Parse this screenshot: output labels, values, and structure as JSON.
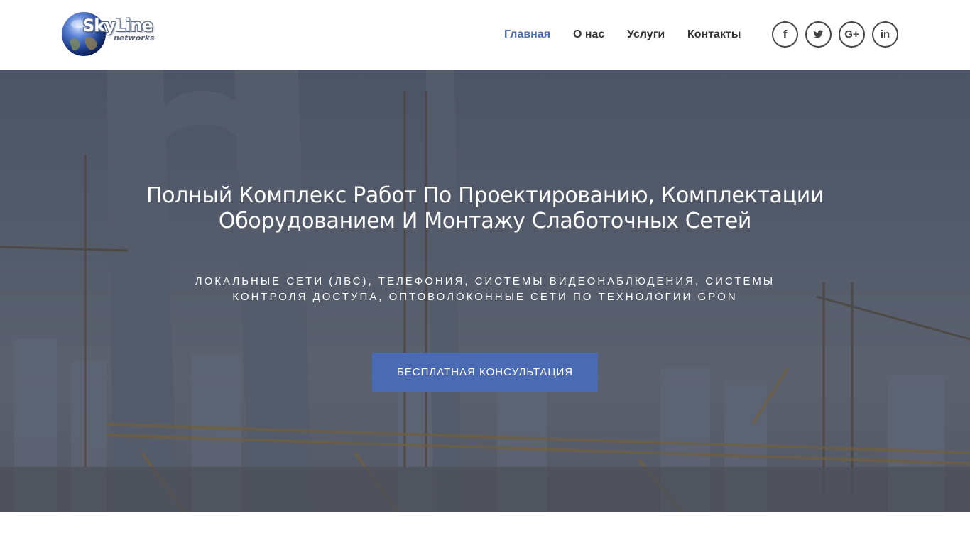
{
  "brand": {
    "name": "SkyLine",
    "subtitle": "networks"
  },
  "nav": {
    "items": [
      {
        "label": "Главная",
        "active": true
      },
      {
        "label": "О нас",
        "active": false
      },
      {
        "label": "Услуги",
        "active": false
      },
      {
        "label": "Контакты",
        "active": false
      }
    ],
    "active_color": "#4a6aa8"
  },
  "social": [
    {
      "icon": "facebook-icon",
      "glyph": "f"
    },
    {
      "icon": "twitter-icon",
      "glyph": "🐦"
    },
    {
      "icon": "google-plus-icon",
      "glyph": "G+"
    },
    {
      "icon": "linkedin-icon",
      "glyph": "in"
    }
  ],
  "hero": {
    "title": "Полный Комплекс Работ По Проектированию, Комплектации Оборудованием И Монтажу Слаботочных Сетей",
    "subtitle": "ЛОКАЛЬНЫЕ СЕТИ (ЛВС), ТЕЛЕФОНИЯ, СИСТЕМЫ ВИДЕОНАБЛЮДЕНИЯ, СИСТЕМЫ КОНТРОЛЯ ДОСТУПА, ОПТОВОЛОКОННЫЕ СЕТИ ПО ТЕХНОЛОГИИ GPON",
    "cta_label": "БЕСПЛАТНАЯ КОНСУЛЬТАЦИЯ",
    "cta_color": "#4a6ab4"
  }
}
